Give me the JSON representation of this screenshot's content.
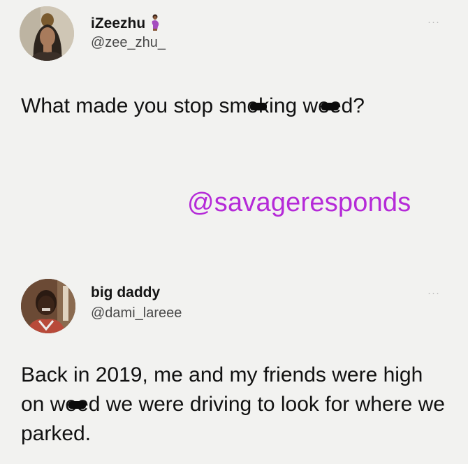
{
  "tweets": [
    {
      "display_name": "iZeezhu",
      "name_emoji": "pregnant-woman-emoji",
      "handle": "@zee_zhu_",
      "more_label": "···",
      "text_parts": [
        "What made you stop sm",
        "ok",
        "ing w",
        "ee",
        "d?"
      ]
    },
    {
      "display_name": "big daddy",
      "handle": "@dami_lareee",
      "more_label": "···",
      "text_parts": [
        "Back in 2019, me and my friends were high on w",
        "ee",
        "d we were driving to look for where we parked."
      ]
    }
  ],
  "watermark": "@savageresponds",
  "colors": {
    "background": "#f2f2f0",
    "watermark": "#b52ad8",
    "handle": "#4a4a4a"
  }
}
